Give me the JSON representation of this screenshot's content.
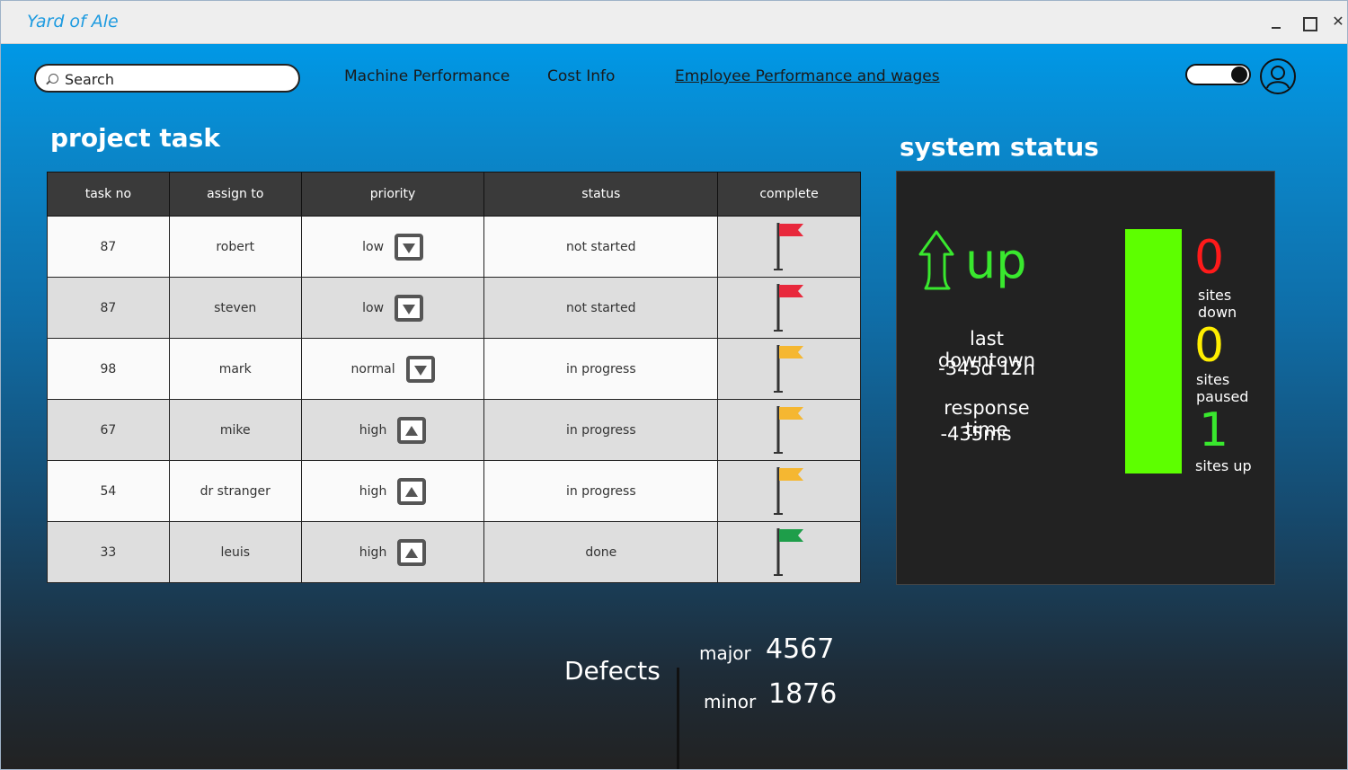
{
  "window": {
    "title": "Yard of Ale"
  },
  "search": {
    "placeholder": "Search"
  },
  "nav": [
    {
      "label": "Machine Performance"
    },
    {
      "label": "Cost Info"
    },
    {
      "label": "Employee Performance and wages"
    }
  ],
  "project": {
    "title": "project task",
    "columns": [
      "task no",
      "assign to",
      "priority",
      "status",
      "complete"
    ],
    "rows": [
      {
        "task_no": "87",
        "assign_to": "robert",
        "priority": "low",
        "priority_dir": "down",
        "status": "not started",
        "flag_color": "#e8283c"
      },
      {
        "task_no": "87",
        "assign_to": "steven",
        "priority": "low",
        "priority_dir": "down",
        "status": "not started",
        "flag_color": "#e8283c"
      },
      {
        "task_no": "98",
        "assign_to": "mark",
        "priority": "normal",
        "priority_dir": "down",
        "status": "in progress",
        "flag_color": "#f5b731"
      },
      {
        "task_no": "67",
        "assign_to": "mike",
        "priority": "high",
        "priority_dir": "up",
        "status": "in progress",
        "flag_color": "#f5b731"
      },
      {
        "task_no": "54",
        "assign_to": "dr stranger",
        "priority": "high",
        "priority_dir": "up",
        "status": "in progress",
        "flag_color": "#f5b731"
      },
      {
        "task_no": "33",
        "assign_to": "leuis",
        "priority": "high",
        "priority_dir": "up",
        "status": "done",
        "flag_color": "#1e9e4a"
      }
    ]
  },
  "system": {
    "title": "system status",
    "state": "up",
    "last_downtime_label": "last downtown",
    "last_downtime_value": "-345d 12h",
    "response_time_label": "response time",
    "response_time_value": "-435ms",
    "sites_down_count": "0",
    "sites_down_label_1": "sites",
    "sites_down_label_2": "down",
    "sites_paused_count": "0",
    "sites_paused_label_1": "sites",
    "sites_paused_label_2": "paused",
    "sites_up_count": "1",
    "sites_up_label": "sites up",
    "colors": {
      "down": "#ff1a1a",
      "paused": "#ffee00",
      "up": "#39e82e",
      "bar": "#5dff00"
    }
  },
  "defects": {
    "title": "Defects",
    "major_label": "major",
    "major_value": "4567",
    "minor_label": "minor",
    "minor_value": "1876"
  }
}
